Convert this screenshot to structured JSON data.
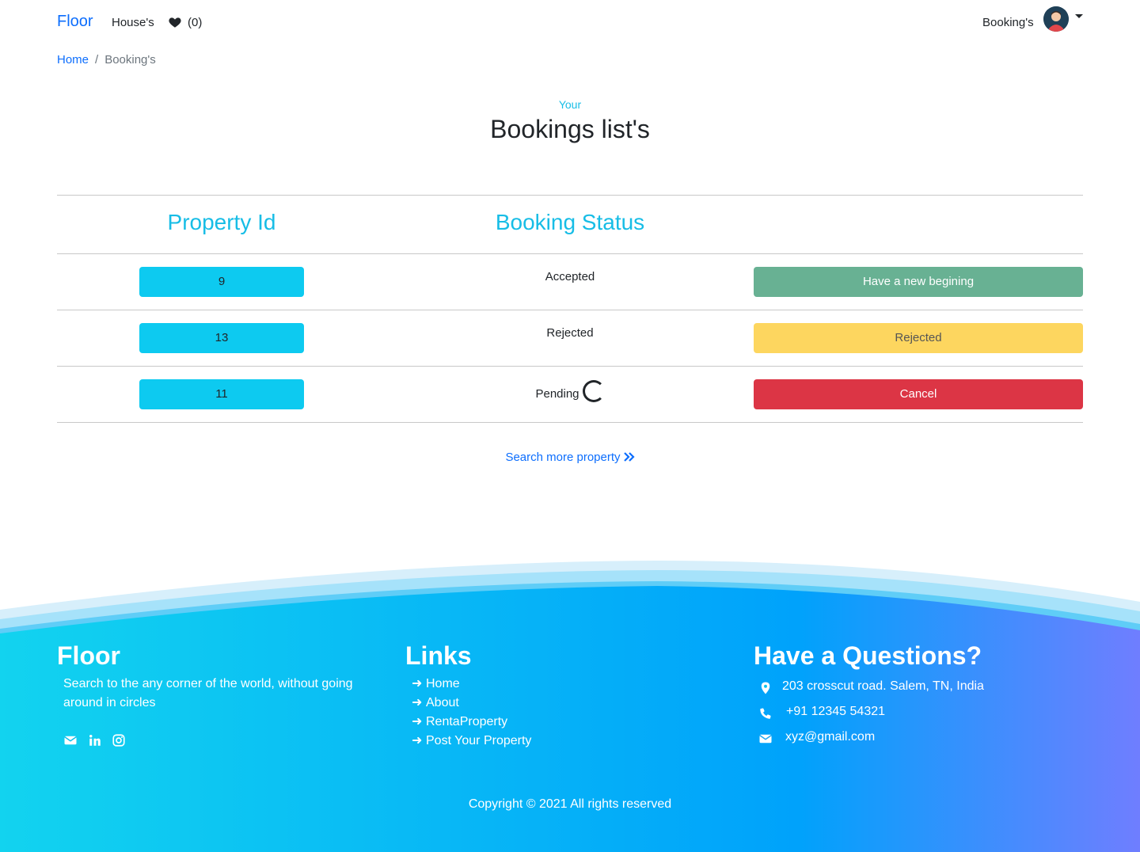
{
  "navbar": {
    "brand": "Floor",
    "houses_label": "House's",
    "wishlist_count": "(0)",
    "bookings_label": "Booking's"
  },
  "breadcrumb": {
    "home": "Home",
    "separator": "/",
    "current": "Booking's"
  },
  "header": {
    "pre_title": "Your",
    "title": "Bookings list's"
  },
  "table": {
    "columns": [
      "Property Id",
      "Booking Status"
    ],
    "rows": [
      {
        "property_id": "9",
        "status": "Accepted",
        "action": "Have a new begining",
        "action_variant": "success"
      },
      {
        "property_id": "13",
        "status": "Rejected",
        "action": "Rejected",
        "action_variant": "warning"
      },
      {
        "property_id": "11",
        "status": "Pending",
        "action": "Cancel",
        "action_variant": "danger"
      }
    ]
  },
  "search_more": "Search more property",
  "footer": {
    "brand": "Floor",
    "description": "Search to the any corner of the world, without going around in circles",
    "social_icons": [
      "envelope-icon",
      "linkedin-icon",
      "instagram-icon"
    ],
    "links_title": "Links",
    "links": [
      "Home",
      "About",
      "RentaProperty",
      "Post Your Property"
    ],
    "questions_title": "Have a Questions?",
    "address": "203 crosscut road. Salem, TN, India",
    "phone": "+91 12345 54321",
    "email": "xyz@gmail.com",
    "copyright": "Copyright © 2021 All rights reserved"
  },
  "colors": {
    "primary_link": "#0d6efd",
    "accent_cyan": "#17bde6",
    "info": "#0dcaf0",
    "success": "#68b193",
    "warning": "#fdd65f",
    "danger": "#dc3545",
    "footer_gradient_start": "#12d3ef",
    "footer_gradient_end": "#6f7eff"
  }
}
